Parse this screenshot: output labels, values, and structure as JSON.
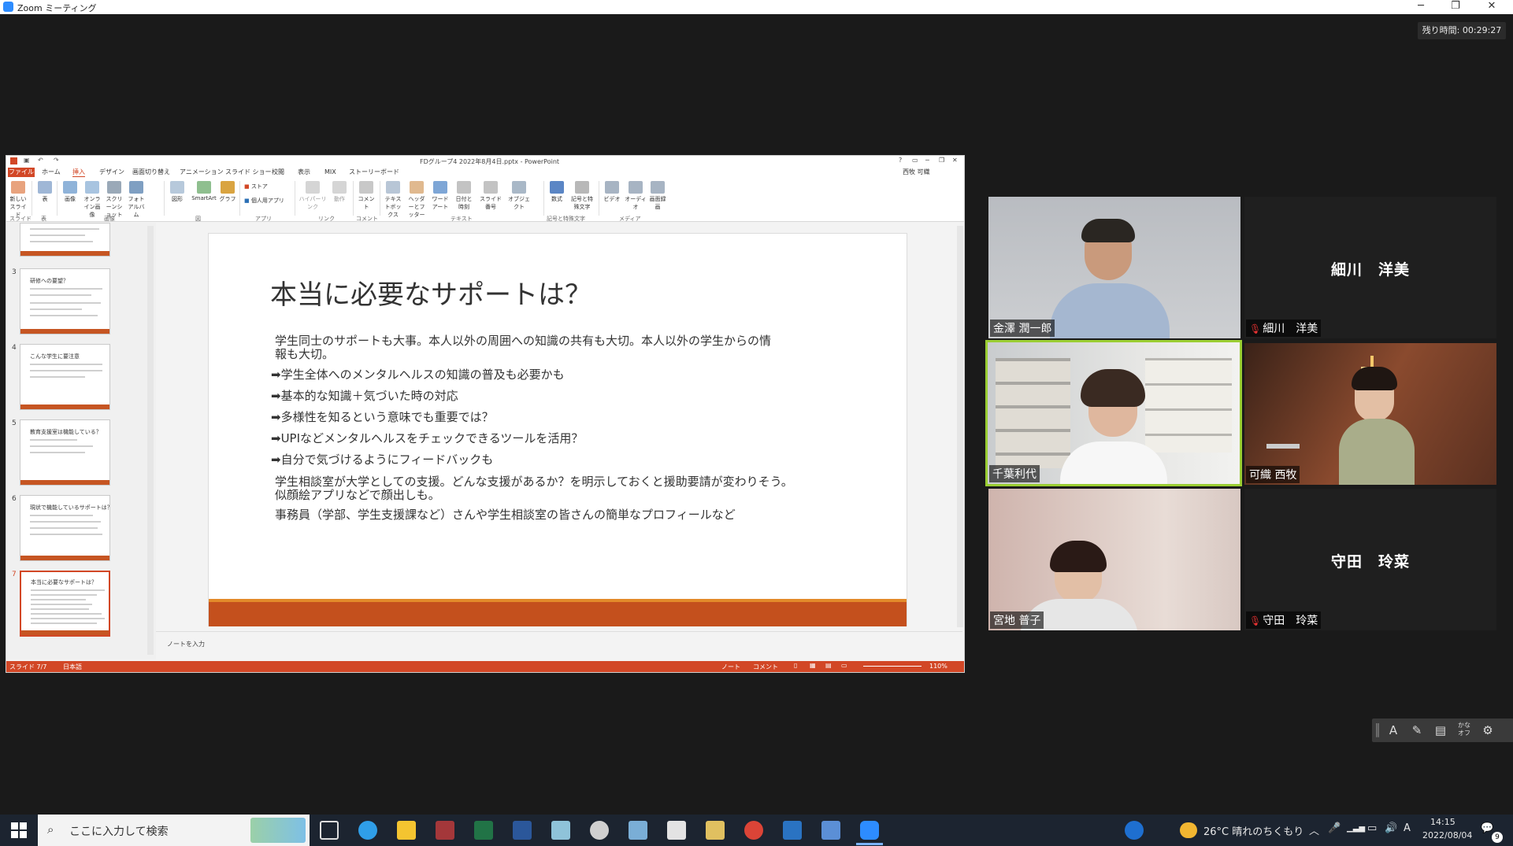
{
  "zoom": {
    "window_title": "Zoom ミーティング",
    "controls": {
      "minimize": "─",
      "restore": "❐",
      "close": "✕"
    },
    "timer": "残り時間: 00:29:27"
  },
  "ppt": {
    "window_title": "FDグループ4 2022年8月4日.pptx - PowerPoint",
    "window_controls": [
      "?",
      "▭",
      "─",
      "❐",
      "✕"
    ],
    "tabs": [
      "ファイル",
      "ホーム",
      "挿入",
      "デザイン",
      "画面切り替え",
      "アニメーション",
      "スライド ショー",
      "校閲",
      "表示",
      "MIX",
      "ストーリーボード"
    ],
    "user": "西牧 可織",
    "ribbon_buttons": [
      "新しいスライド",
      "表",
      "画像",
      "オンライン画像",
      "スクリーンショット",
      "フォトアルバム",
      "図形",
      "SmartArt",
      "グラフ",
      "ストア",
      "個人用アプリ",
      "ハイパーリンク",
      "動作",
      "コメント",
      "テキストボックス",
      "ヘッダーとフッター",
      "ワードアート",
      "日付と時刻",
      "スライド番号",
      "オブジェクト",
      "数式",
      "記号と特殊文字",
      "ビデオ",
      "オーディオ",
      "画面録画"
    ],
    "ribbon_groups": [
      "スライド",
      "表",
      "画像",
      "図",
      "アプリ",
      "リンク",
      "コメント",
      "テキスト",
      "記号と特殊文字",
      "メディア"
    ],
    "thumbnails": [
      {
        "num": "3",
        "title": "研修への要望？"
      },
      {
        "num": "4",
        "title": "こんな学生に要注意"
      },
      {
        "num": "5",
        "title": "教育支援室は機能している？"
      },
      {
        "num": "6",
        "title": "現状で機能しているサポートは？"
      },
      {
        "num": "7",
        "title": "本当に必要なサポートは？"
      }
    ],
    "slide": {
      "title": "本当に必要なサポートは？",
      "para1_line1": "学生同士のサポートも大事。本人以外の周囲への知識の共有も大切。本人以外の学生からの情",
      "para1_line2": "報も大切。",
      "bullets": [
        "➡学生全体へのメンタルヘルスの知識の普及も必要かも",
        "➡基本的な知識＋気づいた時の対応",
        "➡多様性を知るという意味でも重要では？",
        "➡UPIなどメンタルヘルスをチェックできるツールを活用？",
        "➡自分で気づけるようにフィードバックも"
      ],
      "para2_line1": "学生相談室が大学としての支援。どんな支援があるか？を明示しておくと援助要請が変わりそう。",
      "para2_line2": "似顔絵アプリなどで顔出しも。",
      "para3": "事務員（学部、学生支援課など）さんや学生相談室の皆さんの簡単なプロフィールなど"
    },
    "notes_placeholder": "ノートを入力",
    "status": {
      "slide": "スライド 7/7",
      "lang": "日本語",
      "notes": "ノート",
      "comments": "コメント",
      "zoom": "110%"
    }
  },
  "participants": [
    {
      "name": "金澤 潤一郎",
      "video": true,
      "muted": false
    },
    {
      "name": "細川　洋美",
      "video": false,
      "muted": true
    },
    {
      "name": "千葉利代",
      "video": true,
      "muted": false,
      "active": true
    },
    {
      "name": "可織 西牧",
      "video": true,
      "muted": false
    },
    {
      "name": "宮地 普子",
      "video": true,
      "muted": false
    },
    {
      "name": "守田　玲菜",
      "video": false,
      "muted": true
    }
  ],
  "ime_toolbar": {
    "mode": "A",
    "kana": "かな オフ"
  },
  "taskbar": {
    "search_placeholder": "ここに入力して検索",
    "weather": "26°C  晴れのちくもり",
    "ime": "A",
    "time": "14:15",
    "date": "2022/08/04",
    "notification_count": "9"
  },
  "colors": {
    "ppt_accent": "#d24726",
    "slide_bar": "#c4501d",
    "active_speaker": "#9acd32",
    "zoom_blue": "#2d8cff"
  }
}
